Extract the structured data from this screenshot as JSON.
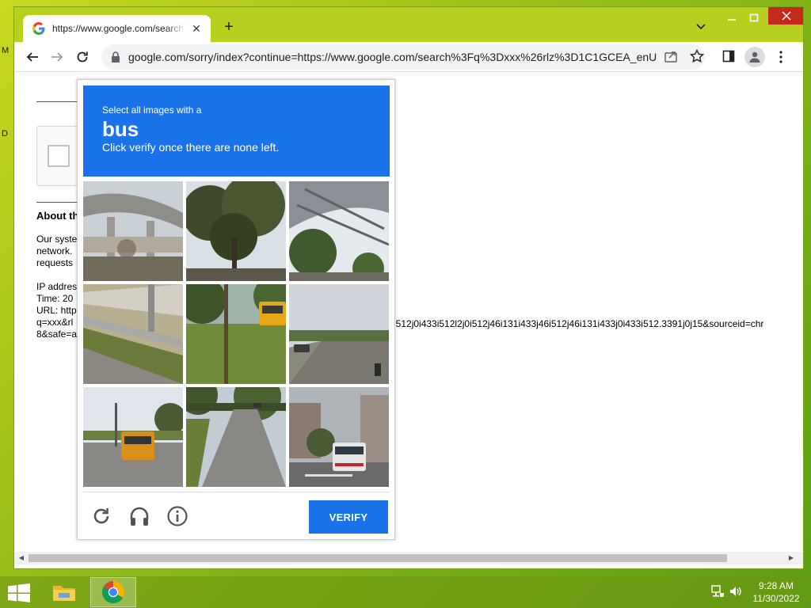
{
  "desktop": {
    "letters": [
      "M",
      "D"
    ]
  },
  "browser": {
    "tab_title": "https://www.google.com/search?q=xxx",
    "tab_close": "✕",
    "new_tab": "+",
    "address": "google.com/sorry/index?continue=https://www.google.com/search%3Fq%3Dxxx%26rlz%3D1C1GCEA_enU..."
  },
  "page": {
    "about_heading": "About th",
    "para1": [
      "Our syste",
      "network.",
      "requests"
    ],
    "para2": [
      "IP addres",
      "Time: 20",
      "URL: http",
      "q=xxx&rl",
      "8&safe=a"
    ],
    "url_continuation": "i512j0i433i512l2j0i512j46i131i433j46i512j46i131i433j0i433i512.3391j0j15&sourceid=chr"
  },
  "captcha": {
    "instruction_line1": "Select all images with a",
    "target": "bus",
    "instruction_line3": "Click verify once there are none left.",
    "verify_label": "VERIFY",
    "tiles": [
      {
        "name": "tile-overpass"
      },
      {
        "name": "tile-trees"
      },
      {
        "name": "tile-bridge"
      },
      {
        "name": "tile-guardrail-road"
      },
      {
        "name": "tile-school-bus-field"
      },
      {
        "name": "tile-road-cars"
      },
      {
        "name": "tile-school-bus-street"
      },
      {
        "name": "tile-empty-road"
      },
      {
        "name": "tile-city-bus-intersection"
      }
    ]
  },
  "taskbar": {
    "time": "9:28 AM",
    "date": "11/30/2022"
  },
  "colors": {
    "accent_blue": "#1a73e8",
    "desktop_green": "#8cbf1a",
    "close_red": "#c42b1c"
  }
}
